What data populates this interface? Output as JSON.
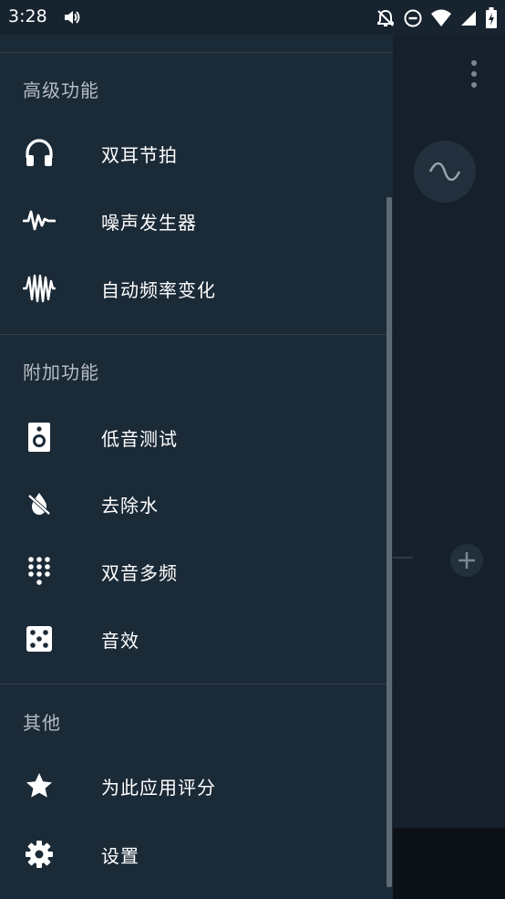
{
  "status_bar": {
    "time": "3:28",
    "icons": [
      "volume-icon",
      "notifications-off-icon",
      "do-not-disturb-icon",
      "wifi-icon",
      "cell-signal-icon",
      "battery-charging-icon"
    ]
  },
  "drawer": {
    "sections": [
      {
        "title": "高级功能",
        "items": [
          {
            "label": "双耳节拍",
            "icon": "headphones-icon"
          },
          {
            "label": "噪声发生器",
            "icon": "noise-wave-icon"
          },
          {
            "label": "自动频率变化",
            "icon": "frequency-sweep-icon"
          }
        ]
      },
      {
        "title": "附加功能",
        "items": [
          {
            "label": "低音测试",
            "icon": "speaker-icon"
          },
          {
            "label": "去除水",
            "icon": "water-off-icon"
          },
          {
            "label": "双音多频",
            "icon": "dialpad-icon"
          },
          {
            "label": "音效",
            "icon": "dice-icon"
          }
        ]
      },
      {
        "title": "其他",
        "items": [
          {
            "label": "为此应用评分",
            "icon": "star-icon"
          },
          {
            "label": "设置",
            "icon": "gear-icon"
          }
        ]
      }
    ]
  },
  "colors": {
    "drawer_bg": "#1b2a37",
    "text": "#ffffff",
    "section_title": "#b5bcc3",
    "icon": "#ffffff",
    "divider": "#33414d"
  }
}
